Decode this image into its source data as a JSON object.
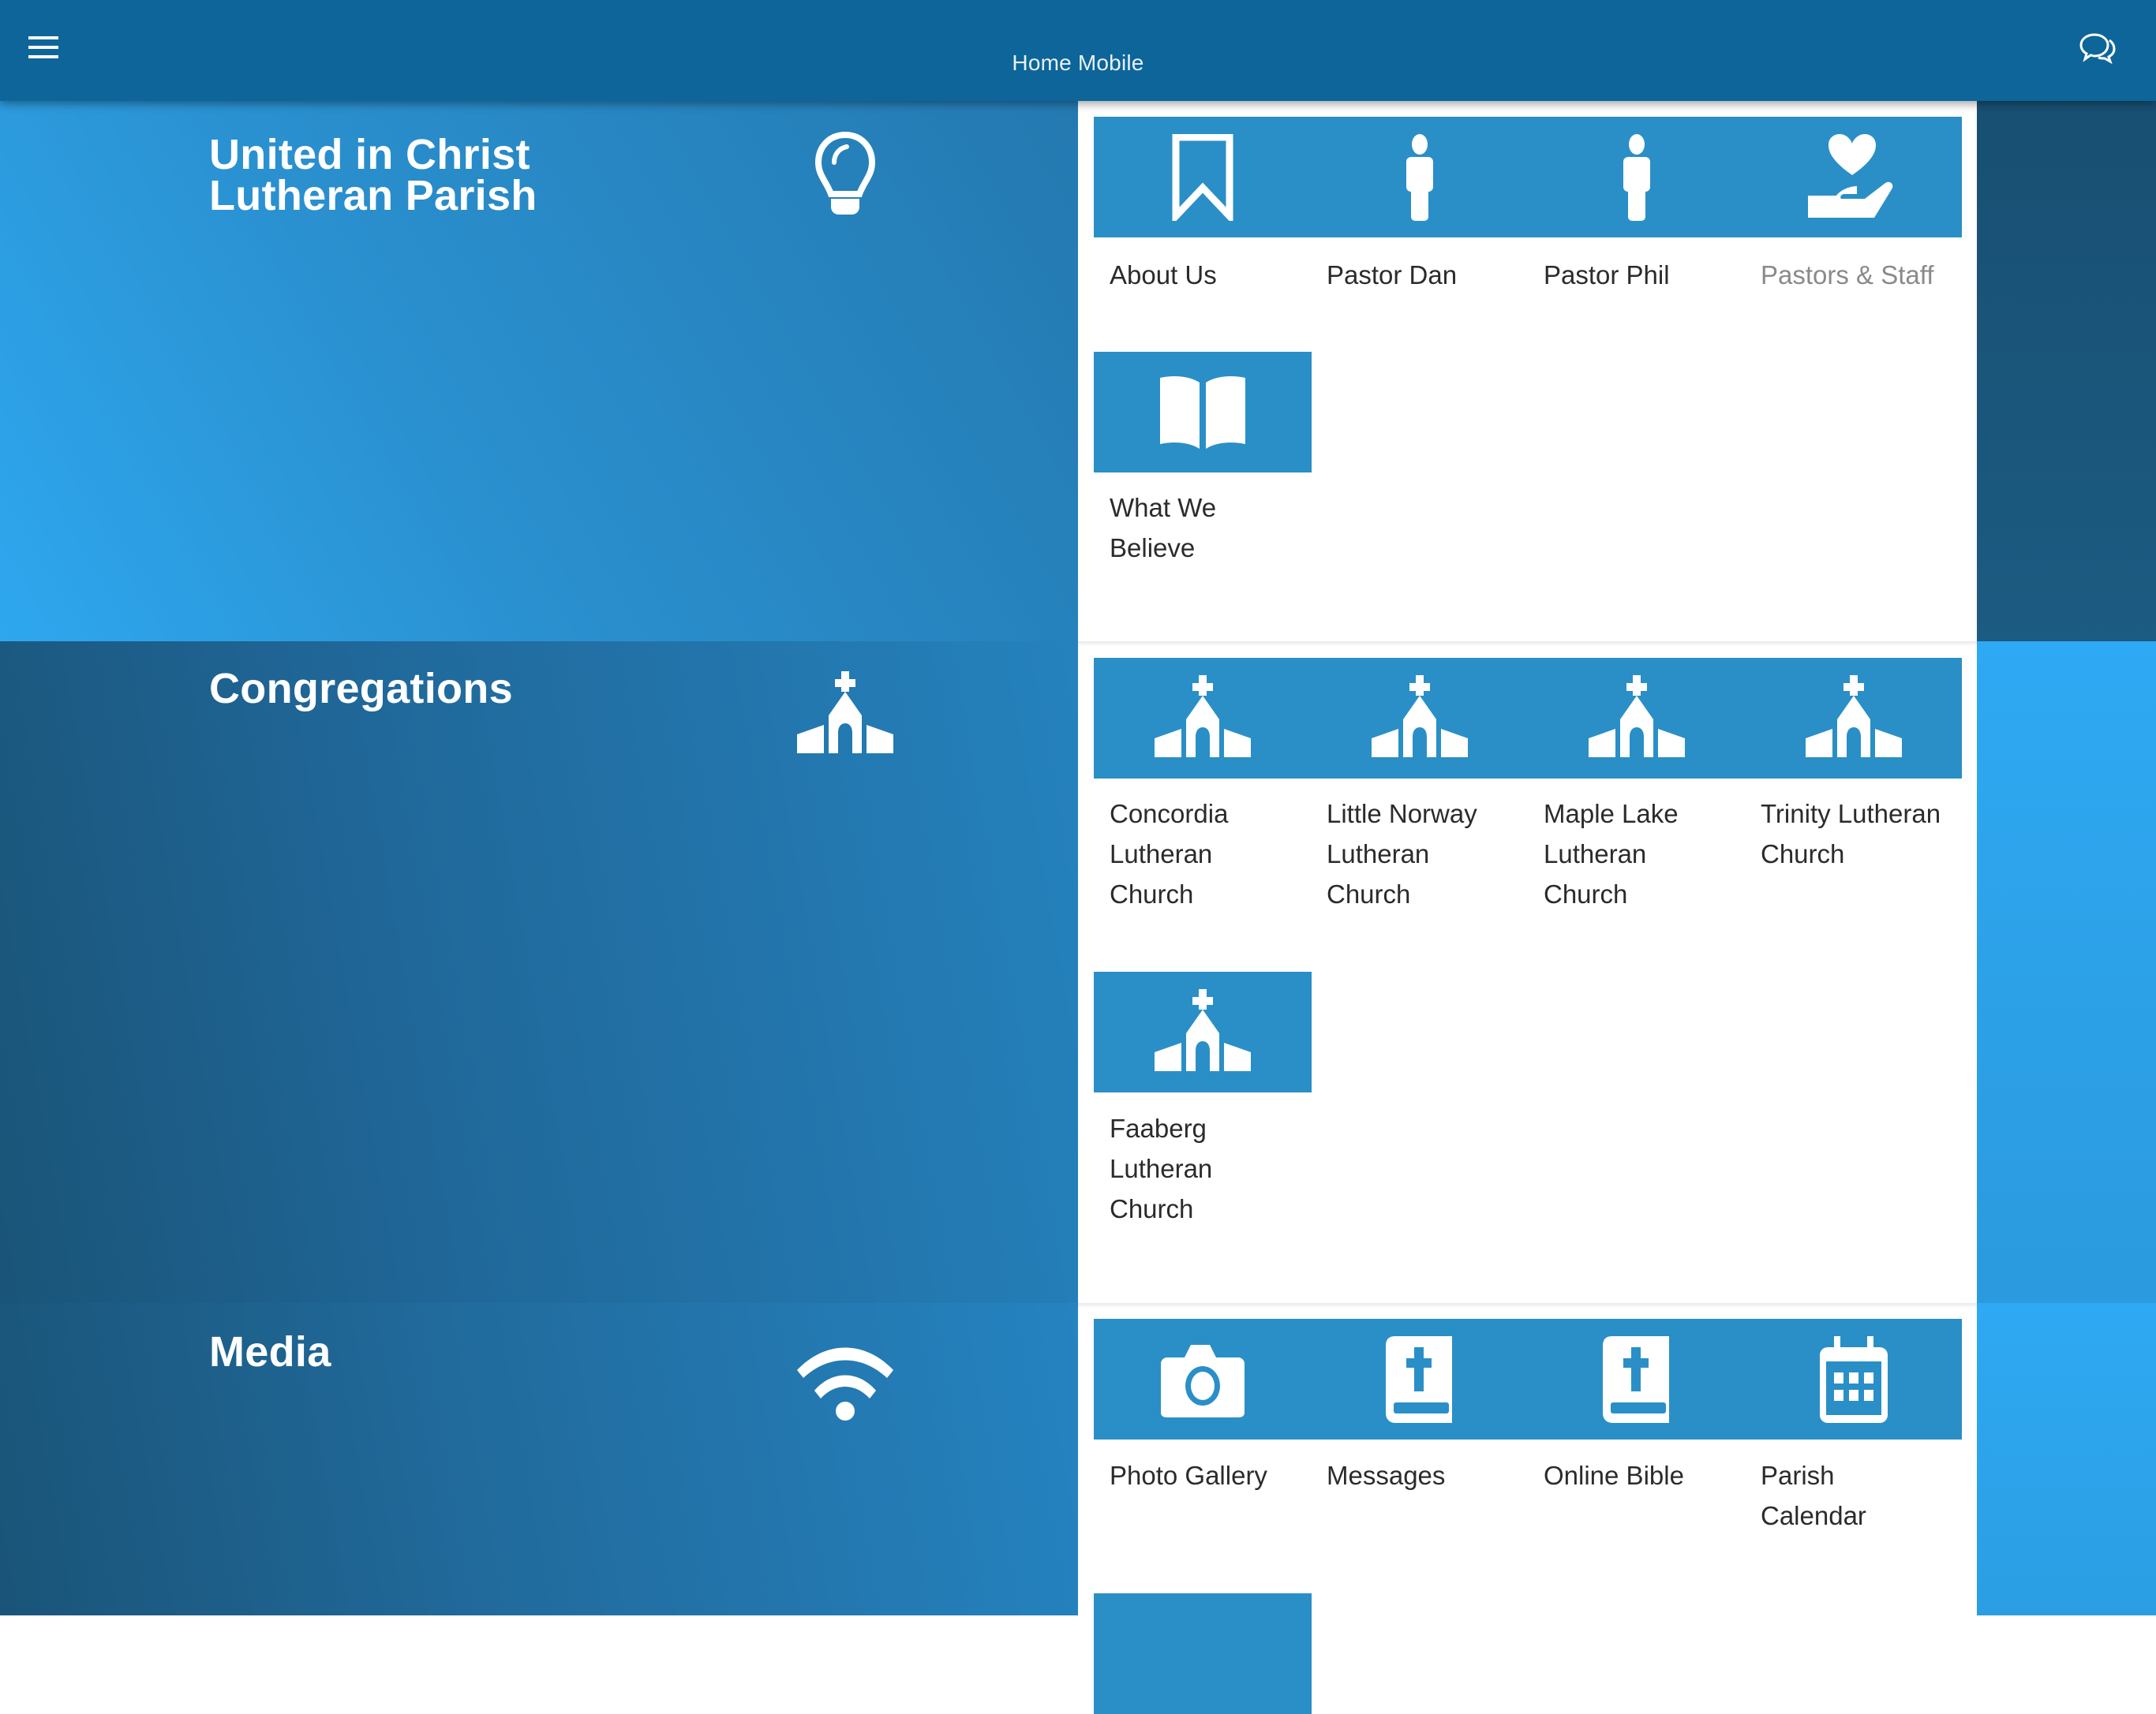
{
  "header": {
    "title": "Home Mobile",
    "menu_icon": "hamburger-menu-icon",
    "chat_icon": "chat-bubbles-icon",
    "background_color": "#0d659a"
  },
  "colors": {
    "tile_background": "#2a8fc7",
    "label_text": "#2b2b2b",
    "label_muted": "#8a8a8a"
  },
  "sections": [
    {
      "title": "United in Christ Lutheran Parish",
      "title_lines": [
        "United in Christ",
        "Lutheran Parish"
      ],
      "icon": "lightbulb-icon",
      "tiles": [
        {
          "label": "About Us",
          "icon": "bookmark-icon"
        },
        {
          "label": "Pastor Dan",
          "icon": "person-icon"
        },
        {
          "label": "Pastor Phil",
          "icon": "person-icon"
        },
        {
          "label": "Pastors & Staff",
          "icon": "hand-heart-icon",
          "muted": true
        },
        {
          "label": "What We Believe",
          "label_lines": [
            "What We",
            "Believe"
          ],
          "icon": "open-book-icon"
        }
      ]
    },
    {
      "title": "Congregations",
      "icon": "church-icon",
      "tiles": [
        {
          "label": "Concordia Lutheran Church",
          "label_lines": [
            "Concordia",
            "Lutheran",
            "Church"
          ],
          "icon": "church-icon"
        },
        {
          "label": "Little Norway Lutheran Church",
          "label_lines": [
            "Little Norway",
            "Lutheran",
            "Church"
          ],
          "icon": "church-icon"
        },
        {
          "label": "Maple Lake Lutheran Church",
          "label_lines": [
            "Maple Lake",
            "Lutheran",
            "Church"
          ],
          "icon": "church-icon"
        },
        {
          "label": "Trinity Lutheran Church",
          "label_lines": [
            "Trinity Lutheran",
            "Church"
          ],
          "icon": "church-icon"
        },
        {
          "label": "Faaberg Lutheran Church",
          "label_lines": [
            "Faaberg",
            "Lutheran",
            "Church"
          ],
          "icon": "church-icon"
        }
      ]
    },
    {
      "title": "Media",
      "icon": "wifi-signal-icon",
      "tiles": [
        {
          "label": "Photo Gallery",
          "icon": "camera-icon"
        },
        {
          "label": "Messages",
          "icon": "bible-icon"
        },
        {
          "label": "Online Bible",
          "icon": "bible-icon"
        },
        {
          "label": "Parish Calendar",
          "label_lines": [
            "Parish",
            "Calendar"
          ],
          "icon": "calendar-icon"
        }
      ]
    }
  ]
}
